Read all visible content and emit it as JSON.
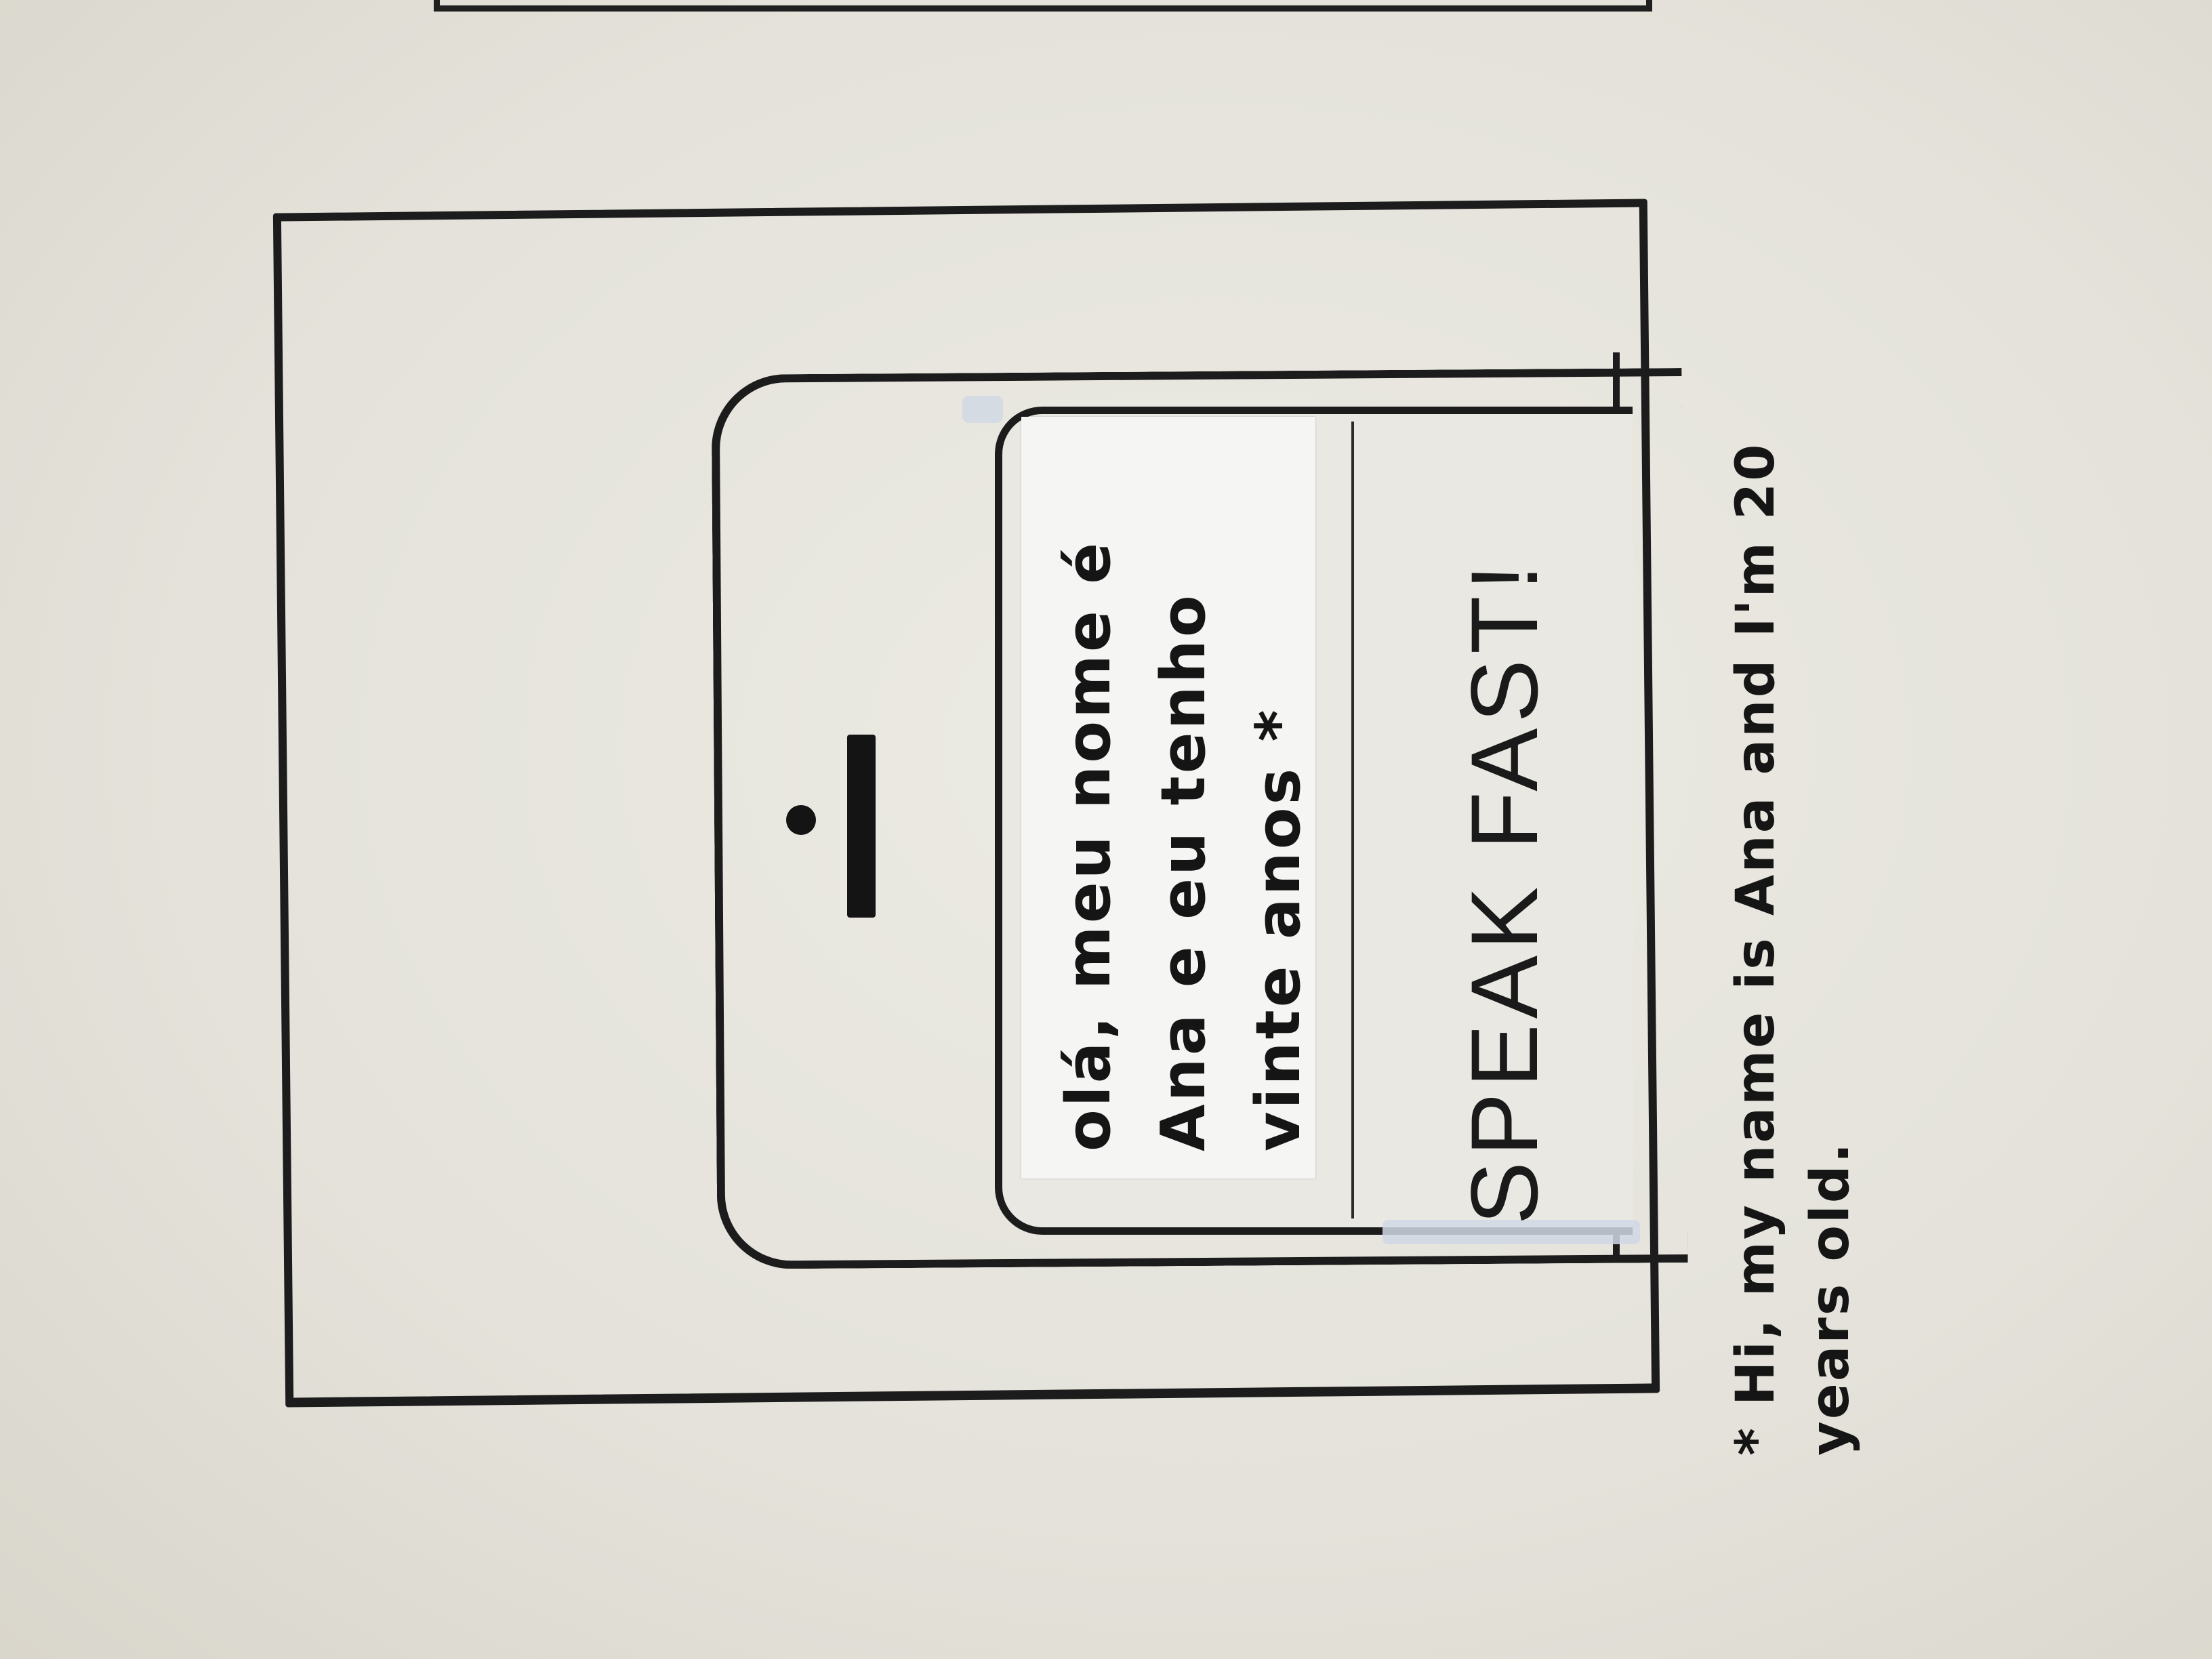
{
  "sketch": {
    "translation_bubble": {
      "text": "olá, meu nome é Ana e eu tenho vinte anos *"
    },
    "prompt": {
      "text": "SPEAK FAST!"
    },
    "footnote": {
      "text": "* Hi, my name is Ana and I'm 20 years old."
    }
  }
}
